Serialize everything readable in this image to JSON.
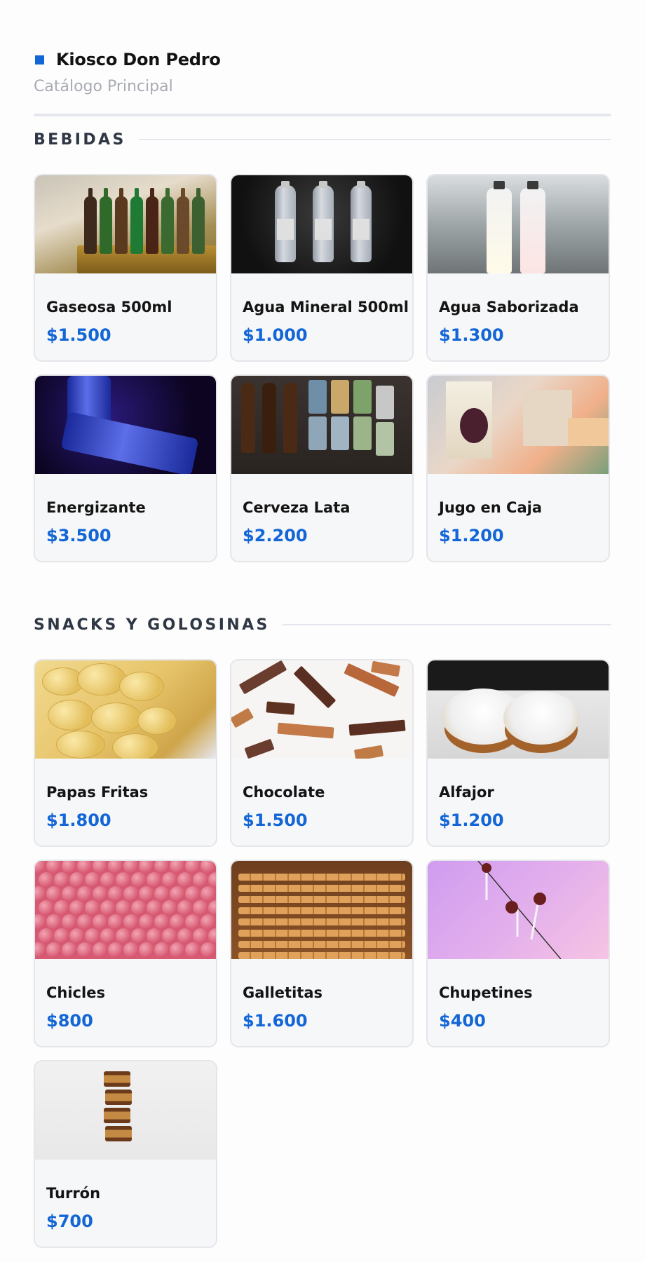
{
  "header": {
    "title": "Kiosco Don Pedro",
    "subtitle": "Catálogo Principal"
  },
  "sections": [
    {
      "title": "BEBIDAS",
      "items": [
        {
          "name": "Gaseosa 500ml",
          "price": "$1.500",
          "image": "soda-bottles-photo"
        },
        {
          "name": "Agua Mineral 500ml",
          "price": "$1.000",
          "image": "water-bottles-photo"
        },
        {
          "name": "Agua Saborizada",
          "price": "$1.300",
          "image": "flavored-water-photo"
        },
        {
          "name": "Energizante",
          "price": "$3.500",
          "image": "energy-drink-photo"
        },
        {
          "name": "Cerveza Lata",
          "price": "$2.200",
          "image": "beer-cans-photo"
        },
        {
          "name": "Jugo en Caja",
          "price": "$1.200",
          "image": "juice-box-photo"
        }
      ]
    },
    {
      "title": "SNACKS Y GOLOSINAS",
      "items": [
        {
          "name": "Papas Fritas",
          "price": "$1.800",
          "image": "potato-chips-photo"
        },
        {
          "name": "Chocolate",
          "price": "$1.500",
          "image": "chocolate-sticks-photo"
        },
        {
          "name": "Alfajor",
          "price": "$1.200",
          "image": "alfajor-photo"
        },
        {
          "name": "Chicles",
          "price": "$800",
          "image": "gum-balls-photo"
        },
        {
          "name": "Galletitas",
          "price": "$1.600",
          "image": "cookies-photo"
        },
        {
          "name": "Chupetines",
          "price": "$400",
          "image": "lollipops-photo"
        },
        {
          "name": "Turrón",
          "price": "$700",
          "image": "turron-photo"
        }
      ]
    }
  ],
  "colors": {
    "accent": "#1366d6",
    "card_bg": "#f6f7f9",
    "card_border": "#e5e6ea",
    "muted_text": "#a9abb4",
    "section_title": "#2f3744"
  }
}
